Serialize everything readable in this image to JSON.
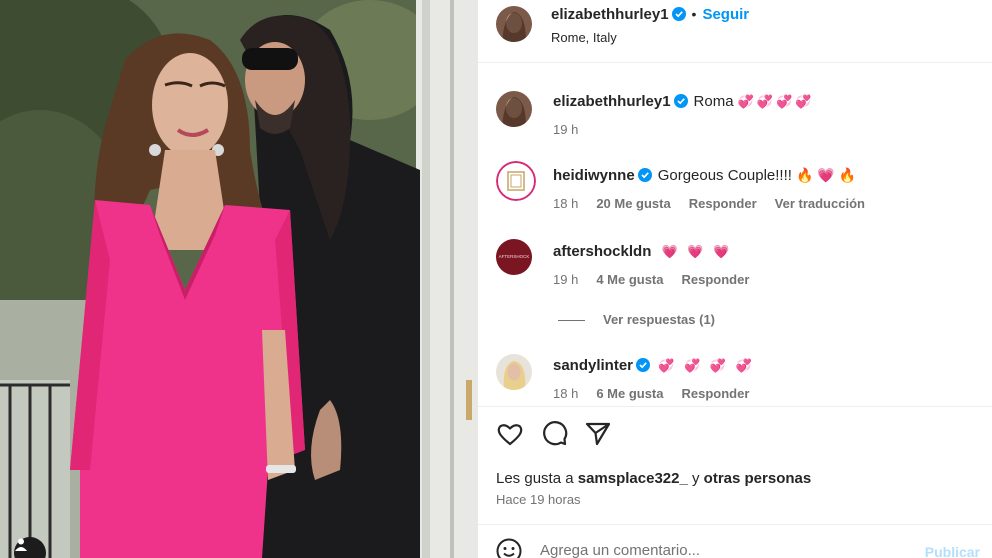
{
  "post": {
    "username": "elizabethhurley1",
    "follow_label": "Seguir",
    "separator": "•",
    "location": "Rome, Italy"
  },
  "caption": {
    "username": "elizabethhurley1",
    "text": "Roma",
    "hearts": "💞💞💞💞",
    "time": "19 h"
  },
  "comments": [
    {
      "username": "heidiwynne",
      "verified": true,
      "text": "Gorgeous Couple!!!!",
      "emoji": "🔥 💗 🔥",
      "time": "18 h",
      "likes": "20 Me gusta",
      "reply": "Responder",
      "translate": "Ver traducción"
    },
    {
      "username": "aftershockldn",
      "verified": false,
      "text": "",
      "emoji": "💗 💗 💗",
      "time": "19 h",
      "likes": "4 Me gusta",
      "reply": "Responder"
    },
    {
      "username": "sandylinter",
      "verified": true,
      "text": "",
      "emoji": "💞 💞 💞 💞",
      "time": "18 h",
      "likes": "6 Me gusta",
      "reply": "Responder"
    }
  ],
  "view_replies": "Ver respuestas (1)",
  "likes_line": {
    "prefix": "Les gusta a",
    "user": "samsplace322_",
    "mid": "y",
    "rest": "otras personas"
  },
  "posted_ago": "Hace 19 horas",
  "comment_input": {
    "placeholder": "Agrega un comentario...",
    "publish_label": "Publicar"
  },
  "icons": {
    "verified": "verified-badge-icon",
    "like": "heart-outline-icon",
    "comment": "comment-bubble-icon",
    "share": "paper-plane-icon",
    "emoji": "smiley-icon",
    "tag": "user-tag-icon"
  },
  "colors": {
    "accent": "#0095f6",
    "dress": "#f0338a",
    "secondary_text": "#737373"
  }
}
